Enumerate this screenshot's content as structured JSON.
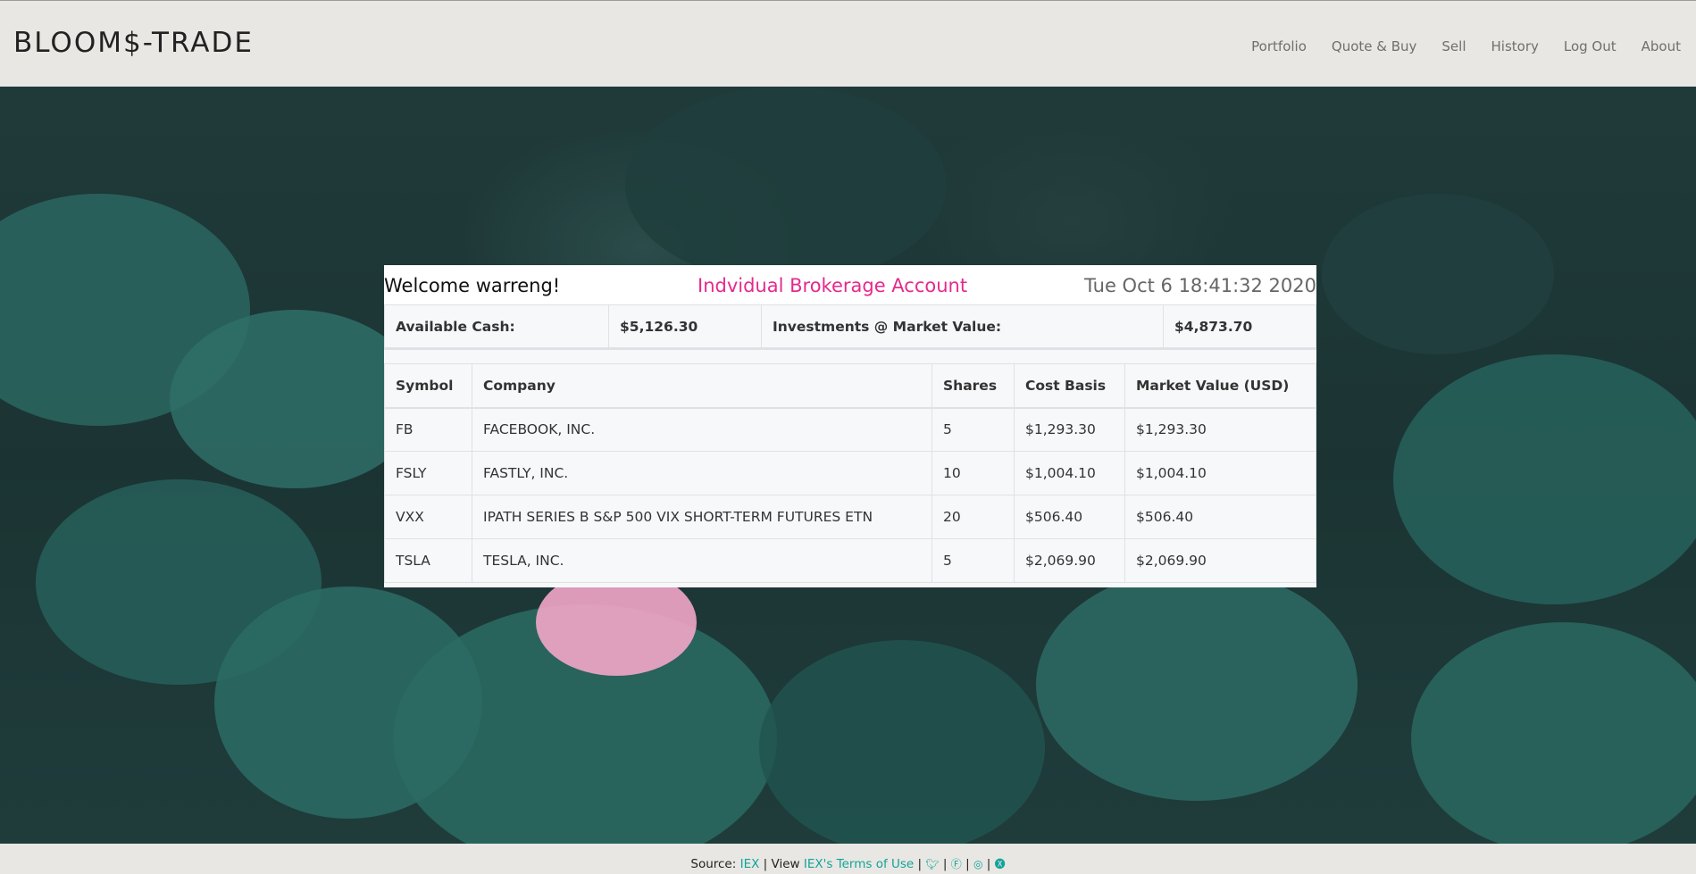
{
  "brand": "BLOOM$-TRADE",
  "nav": [
    "Portfolio",
    "Quote & Buy",
    "Sell",
    "History",
    "Log Out",
    "About"
  ],
  "welcome": "Welcome warreng!",
  "account_title": "Indvidual Brokerage Account",
  "datetime": "Tue Oct 6 18:41:32 2020",
  "summary": {
    "cash_label": "Available Cash:",
    "cash_value": "$5,126.30",
    "investments_label": "Investments @ Market Value:",
    "investments_value": "$4,873.70"
  },
  "holdings": {
    "headers": [
      "Symbol",
      "Company",
      "Shares",
      "Cost Basis",
      "Market Value (USD)"
    ],
    "rows": [
      [
        "FB",
        "FACEBOOK, INC.",
        "5",
        "$1,293.30",
        "$1,293.30"
      ],
      [
        "FSLY",
        "FASTLY, INC.",
        "10",
        "$1,004.10",
        "$1,004.10"
      ],
      [
        "VXX",
        "IPATH SERIES B S&P 500 VIX SHORT-TERM FUTURES ETN",
        "20",
        "$506.40",
        "$506.40"
      ],
      [
        "TSLA",
        "TESLA, INC.",
        "5",
        "$2,069.90",
        "$2,069.90"
      ]
    ]
  },
  "footer": {
    "source_label": "Source:",
    "source_link": "IEX",
    "sep": "|",
    "view_label": "View",
    "terms_link": "IEX's Terms of Use"
  },
  "icons": [
    "twitter-icon",
    "facebook-icon",
    "instagram-icon",
    "linkedin-icon"
  ],
  "colors": {
    "accent": "#e52a8d",
    "link": "#12a39a",
    "header_bg": "#e8e7e3"
  }
}
